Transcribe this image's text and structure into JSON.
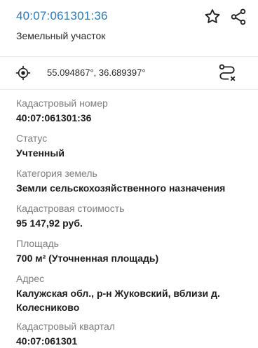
{
  "header": {
    "title": "40:07:061301:36",
    "subtitle": "Земельный участок"
  },
  "location": {
    "coordinates": "55.094867°, 36.689397°"
  },
  "icons": {
    "favorite": "star-outline-icon",
    "share": "share-icon",
    "locate": "crosshair-target-icon",
    "route": "route-icon"
  },
  "colors": {
    "accent": "#2b79b8",
    "label": "#7d7d7d",
    "value": "#1c1c1c"
  },
  "properties": [
    {
      "label": "Кадастровый номер",
      "value": "40:07:061301:36"
    },
    {
      "label": "Статус",
      "value": "Учтенный"
    },
    {
      "label": "Категория земель",
      "value": "Земли сельскохозяйственного назначения"
    },
    {
      "label": "Кадастровая стоимость",
      "value": "95 147,92 руб."
    },
    {
      "label": "Площадь",
      "value": "700 м² (Уточненная площадь)"
    },
    {
      "label": "Адрес",
      "value": "Калужская обл., р-н Жуковский, вблизи д. Колесниково"
    },
    {
      "label": "Кадастровый квартал",
      "value": "40:07:061301"
    }
  ]
}
